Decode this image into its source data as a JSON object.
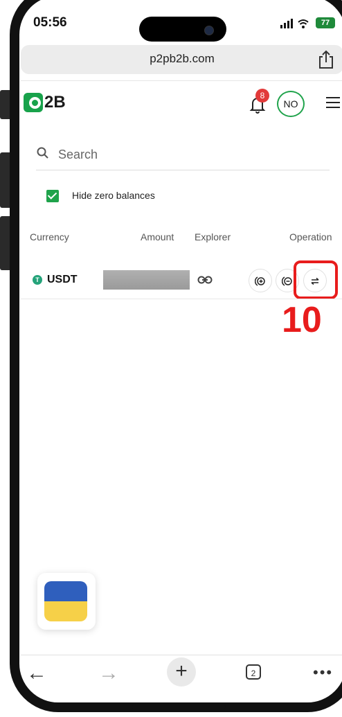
{
  "status_bar": {
    "time": "05:56",
    "signal": "▂▄▆",
    "wifi": "wifi",
    "battery": "77"
  },
  "browser": {
    "url": "p2pb2b.com",
    "share_icon": "share-icon"
  },
  "header": {
    "logo_text": "2B",
    "notification_count": "8",
    "avatar_initials": "NO",
    "menu_icon": "hamburger-icon"
  },
  "search": {
    "placeholder": "Search"
  },
  "filter": {
    "hide_zero_label": "Hide zero balances",
    "checked": true
  },
  "table": {
    "columns": [
      "Currency",
      "Amount",
      "Explorer",
      "Operation"
    ],
    "rows": [
      {
        "currency": "USDT",
        "coin_glyph": "T",
        "amount": "",
        "operations": [
          "deposit",
          "withdraw",
          "transfer"
        ]
      }
    ]
  },
  "annotation": {
    "number": "10"
  },
  "bottom_nav": {
    "tabs_count": "2"
  },
  "colors": {
    "brand_green": "#1fa34b",
    "alert_red": "#e81c1c",
    "flag_blue": "#2f5fbd",
    "flag_yellow": "#f6d048"
  }
}
